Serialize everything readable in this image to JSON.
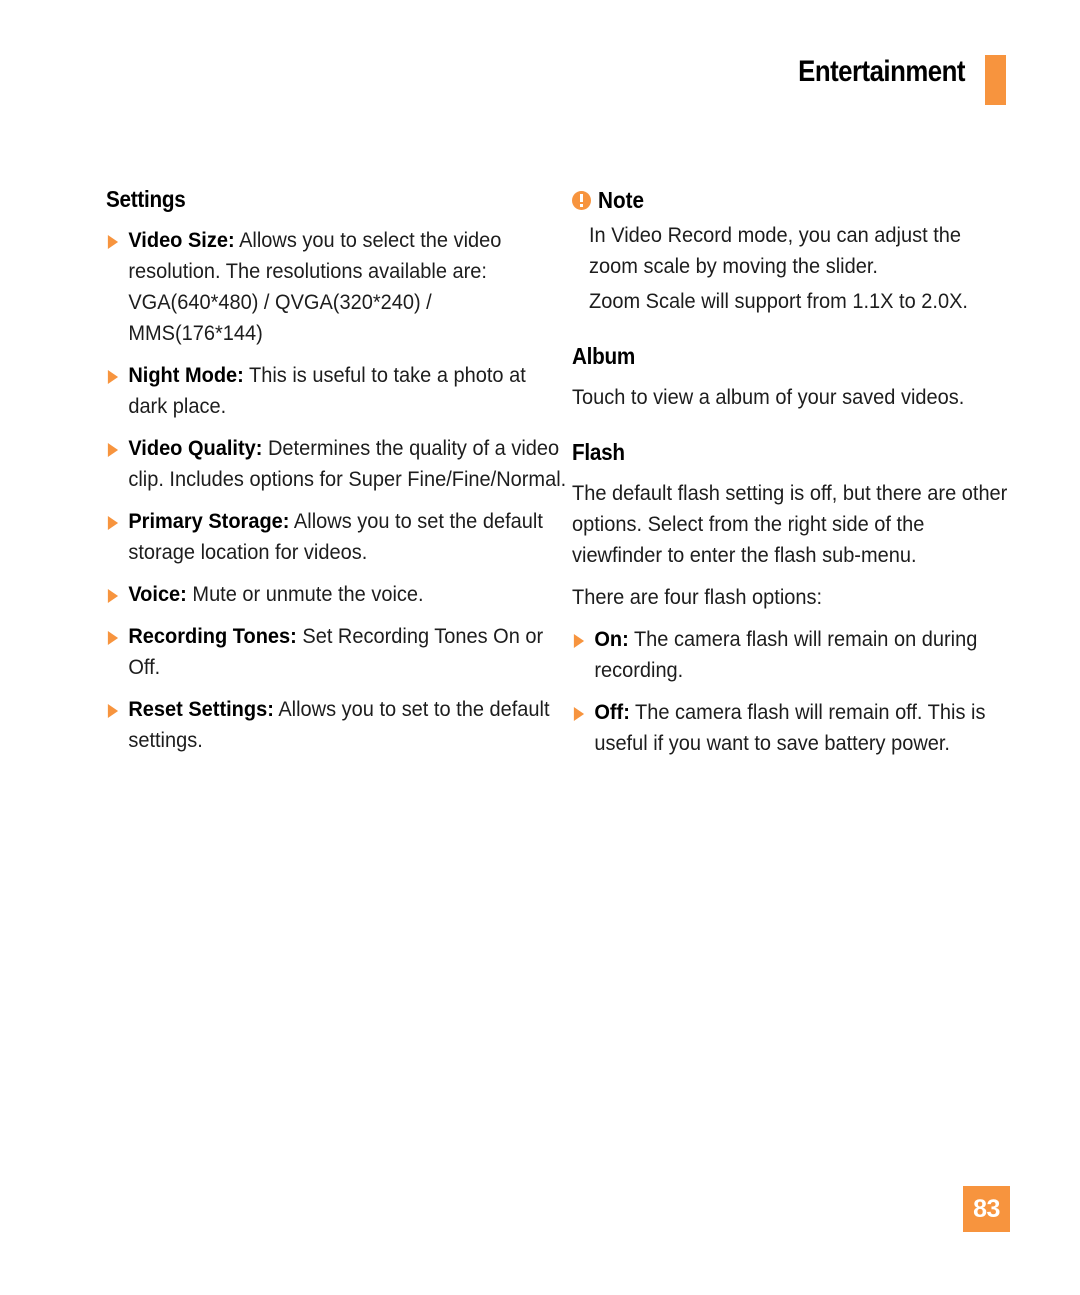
{
  "header": {
    "title": "Entertainment",
    "accent_color": "#F7943E"
  },
  "left_column": {
    "heading": "Settings",
    "bullets": [
      {
        "term": "Video Size:",
        "desc": " Allows you to select the video resolution. The resolutions available are: VGA(640*480) / QVGA(320*240) / MMS(176*144)"
      },
      {
        "term": "Night Mode:",
        "desc": " This is useful to take a photo at dark place."
      },
      {
        "term": "Video Quality:",
        "desc": " Determines the quality of a video clip. Includes options for Super Fine/Fine/Normal."
      },
      {
        "term": "Primary Storage:",
        "desc": " Allows you to set the default storage location for videos."
      },
      {
        "term": "Voice:",
        "desc": " Mute or unmute the voice."
      },
      {
        "term": "Recording Tones:",
        "desc": " Set Recording Tones On or Off."
      },
      {
        "term": "Reset Settings:",
        "desc": " Allows you to set to the default settings."
      }
    ]
  },
  "right_column": {
    "note": {
      "label": "Note",
      "icon": "exclamation-circle-icon",
      "lines": [
        "In Video Record mode, you can adjust the zoom scale by moving the slider.",
        "Zoom Scale will support from 1.1X to 2.0X."
      ]
    },
    "album": {
      "heading": "Album",
      "body": "Touch to view a album of your saved videos."
    },
    "flash": {
      "heading": "Flash",
      "paragraphs": [
        "The default flash setting is off, but there are other options. Select from the right side of the viewfinder to enter the flash sub-menu.",
        "There are four flash options:"
      ],
      "bullets": [
        {
          "term": "On:",
          "desc": " The camera flash will remain on during recording."
        },
        {
          "term": "Off:",
          "desc": " The camera flash will remain off. This is useful if you want to save battery power."
        }
      ]
    }
  },
  "footer": {
    "page_number": "83"
  }
}
